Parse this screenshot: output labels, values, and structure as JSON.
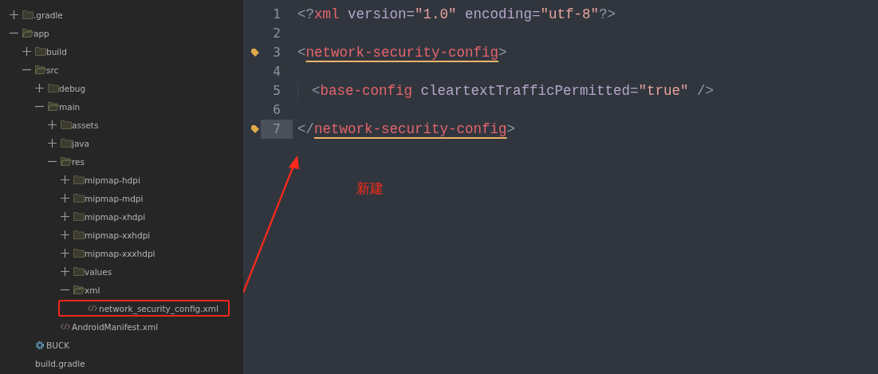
{
  "tree": [
    {
      "label": ".gradle",
      "kind": "folder",
      "expanded": false
    },
    {
      "label": "app",
      "kind": "folder",
      "expanded": true,
      "children": [
        {
          "label": "build",
          "kind": "folder",
          "expanded": false
        },
        {
          "label": "src",
          "kind": "folder",
          "expanded": true,
          "children": [
            {
              "label": "debug",
              "kind": "folder",
              "expanded": false
            },
            {
              "label": "main",
              "kind": "folder",
              "expanded": true,
              "children": [
                {
                  "label": "assets",
                  "kind": "folder",
                  "expanded": false
                },
                {
                  "label": "java",
                  "kind": "folder",
                  "expanded": false
                },
                {
                  "label": "res",
                  "kind": "folder",
                  "expanded": true,
                  "children": [
                    {
                      "label": "mipmap-hdpi",
                      "kind": "folder",
                      "expanded": false
                    },
                    {
                      "label": "mipmap-mdpi",
                      "kind": "folder",
                      "expanded": false
                    },
                    {
                      "label": "mipmap-xhdpi",
                      "kind": "folder",
                      "expanded": false
                    },
                    {
                      "label": "mipmap-xxhdpi",
                      "kind": "folder",
                      "expanded": false
                    },
                    {
                      "label": "mipmap-xxxhdpi",
                      "kind": "folder",
                      "expanded": false
                    },
                    {
                      "label": "values",
                      "kind": "folder",
                      "expanded": false
                    },
                    {
                      "label": "xml",
                      "kind": "folder",
                      "expanded": true,
                      "children": [
                        {
                          "label": "network_security_config.xml",
                          "kind": "xml",
                          "highlighted": true
                        }
                      ]
                    }
                  ]
                },
                {
                  "label": "AndroidManifest.xml",
                  "kind": "xml",
                  "highlighted": false
                }
              ]
            }
          ]
        },
        {
          "label": "BUCK",
          "kind": "gear"
        },
        {
          "label": "build.gradle",
          "kind": "plain"
        }
      ]
    }
  ],
  "editor": {
    "lines": [
      {
        "number": "1",
        "bookmark": false,
        "selected": false,
        "indented": false,
        "tokens": [
          {
            "text": "<?",
            "kind": "punct"
          },
          {
            "text": "xml",
            "kind": "tag"
          },
          {
            "text": " version=",
            "kind": "attr"
          },
          {
            "text": "\"1.0\"",
            "kind": "value"
          },
          {
            "text": " encoding=",
            "kind": "attr"
          },
          {
            "text": "\"utf-8\"",
            "kind": "value"
          },
          {
            "text": "?>",
            "kind": "punct"
          }
        ]
      },
      {
        "number": "2",
        "bookmark": false,
        "selected": false,
        "indented": false
      },
      {
        "number": "3",
        "bookmark": true,
        "selected": false,
        "indented": false,
        "tokens": [
          {
            "text": "<",
            "kind": "punct"
          },
          {
            "text": "network-security-config",
            "kind": "tag",
            "underlined": true
          },
          {
            "text": ">",
            "kind": "punct"
          }
        ]
      },
      {
        "number": "4",
        "bookmark": false,
        "selected": false,
        "indented": false
      },
      {
        "number": "5",
        "bookmark": false,
        "selected": false,
        "indented": true,
        "tokens": [
          {
            "text": "<",
            "kind": "punct"
          },
          {
            "text": "base-config",
            "kind": "tag"
          },
          {
            "text": " cleartextTrafficPermitted=",
            "kind": "attr"
          },
          {
            "text": "\"true\"",
            "kind": "value"
          },
          {
            "text": " />",
            "kind": "punct"
          }
        ]
      },
      {
        "number": "6",
        "bookmark": false,
        "selected": false,
        "indented": false
      },
      {
        "number": "7",
        "bookmark": true,
        "selected": true,
        "indented": false,
        "tokens": [
          {
            "text": "</",
            "kind": "punct"
          },
          {
            "text": "network-security-config",
            "kind": "tag",
            "underlined": true
          },
          {
            "text": ">",
            "kind": "punct"
          }
        ]
      }
    ]
  },
  "annotation": {
    "text": "新建"
  }
}
